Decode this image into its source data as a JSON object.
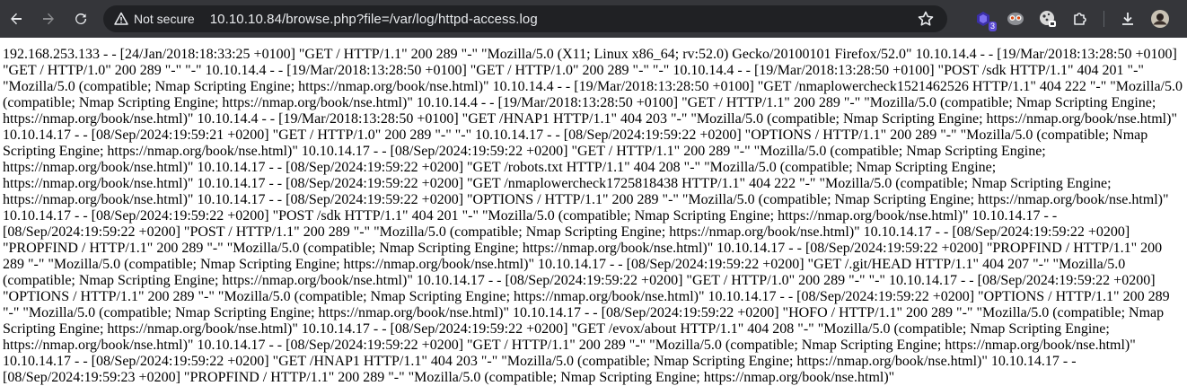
{
  "browser": {
    "security_label": "Not secure",
    "url": "10.10.10.84/browse.php?file=/var/log/httpd-access.log",
    "extensions": [
      {
        "name": "extension-1",
        "badge": "3"
      }
    ]
  },
  "page": {
    "log_text": "192.168.253.133 - - [24/Jan/2018:18:33:25 +0100] \"GET / HTTP/1.1\" 200 289 \"-\" \"Mozilla/5.0 (X11; Linux x86_64; rv:52.0) Gecko/20100101 Firefox/52.0\" 10.10.14.4 - - [19/Mar/2018:13:28:50 +0100] \"GET / HTTP/1.0\" 200 289 \"-\" \"-\" 10.10.14.4 - - [19/Mar/2018:13:28:50 +0100] \"GET / HTTP/1.0\" 200 289 \"-\" \"-\" 10.10.14.4 - - [19/Mar/2018:13:28:50 +0100] \"POST /sdk HTTP/1.1\" 404 201 \"-\" \"Mozilla/5.0 (compatible; Nmap Scripting Engine; https://nmap.org/book/nse.html)\" 10.10.14.4 - - [19/Mar/2018:13:28:50 +0100] \"GET /nmaplowercheck1521462526 HTTP/1.1\" 404 222 \"-\" \"Mozilla/5.0 (compatible; Nmap Scripting Engine; https://nmap.org/book/nse.html)\" 10.10.14.4 - - [19/Mar/2018:13:28:50 +0100] \"GET / HTTP/1.1\" 200 289 \"-\" \"Mozilla/5.0 (compatible; Nmap Scripting Engine; https://nmap.org/book/nse.html)\" 10.10.14.4 - - [19/Mar/2018:13:28:50 +0100] \"GET /HNAP1 HTTP/1.1\" 404 203 \"-\" \"Mozilla/5.0 (compatible; Nmap Scripting Engine; https://nmap.org/book/nse.html)\" 10.10.14.17 - - [08/Sep/2024:19:59:21 +0200] \"GET / HTTP/1.0\" 200 289 \"-\" \"-\" 10.10.14.17 - - [08/Sep/2024:19:59:22 +0200] \"OPTIONS / HTTP/1.1\" 200 289 \"-\" \"Mozilla/5.0 (compatible; Nmap Scripting Engine; https://nmap.org/book/nse.html)\" 10.10.14.17 - - [08/Sep/2024:19:59:22 +0200] \"GET / HTTP/1.1\" 200 289 \"-\" \"Mozilla/5.0 (compatible; Nmap Scripting Engine; https://nmap.org/book/nse.html)\" 10.10.14.17 - - [08/Sep/2024:19:59:22 +0200] \"GET /robots.txt HTTP/1.1\" 404 208 \"-\" \"Mozilla/5.0 (compatible; Nmap Scripting Engine; https://nmap.org/book/nse.html)\" 10.10.14.17 - - [08/Sep/2024:19:59:22 +0200] \"GET /nmaplowercheck1725818438 HTTP/1.1\" 404 222 \"-\" \"Mozilla/5.0 (compatible; Nmap Scripting Engine; https://nmap.org/book/nse.html)\" 10.10.14.17 - - [08/Sep/2024:19:59:22 +0200] \"OPTIONS / HTTP/1.1\" 200 289 \"-\" \"Mozilla/5.0 (compatible; Nmap Scripting Engine; https://nmap.org/book/nse.html)\" 10.10.14.17 - - [08/Sep/2024:19:59:22 +0200] \"POST /sdk HTTP/1.1\" 404 201 \"-\" \"Mozilla/5.0 (compatible; Nmap Scripting Engine; https://nmap.org/book/nse.html)\" 10.10.14.17 - - [08/Sep/2024:19:59:22 +0200] \"POST / HTTP/1.1\" 200 289 \"-\" \"Mozilla/5.0 (compatible; Nmap Scripting Engine; https://nmap.org/book/nse.html)\" 10.10.14.17 - - [08/Sep/2024:19:59:22 +0200] \"PROPFIND / HTTP/1.1\" 200 289 \"-\" \"Mozilla/5.0 (compatible; Nmap Scripting Engine; https://nmap.org/book/nse.html)\" 10.10.14.17 - - [08/Sep/2024:19:59:22 +0200] \"PROPFIND / HTTP/1.1\" 200 289 \"-\" \"Mozilla/5.0 (compatible; Nmap Scripting Engine; https://nmap.org/book/nse.html)\" 10.10.14.17 - - [08/Sep/2024:19:59:22 +0200] \"GET /.git/HEAD HTTP/1.1\" 404 207 \"-\" \"Mozilla/5.0 (compatible; Nmap Scripting Engine; https://nmap.org/book/nse.html)\" 10.10.14.17 - - [08/Sep/2024:19:59:22 +0200] \"GET / HTTP/1.0\" 200 289 \"-\" \"-\" 10.10.14.17 - - [08/Sep/2024:19:59:22 +0200] \"OPTIONS / HTTP/1.1\" 200 289 \"-\" \"Mozilla/5.0 (compatible; Nmap Scripting Engine; https://nmap.org/book/nse.html)\" 10.10.14.17 - - [08/Sep/2024:19:59:22 +0200] \"OPTIONS / HTTP/1.1\" 200 289 \"-\" \"Mozilla/5.0 (compatible; Nmap Scripting Engine; https://nmap.org/book/nse.html)\" 10.10.14.17 - - [08/Sep/2024:19:59:22 +0200] \"HOFO / HTTP/1.1\" 200 289 \"-\" \"Mozilla/5.0 (compatible; Nmap Scripting Engine; https://nmap.org/book/nse.html)\" 10.10.14.17 - - [08/Sep/2024:19:59:22 +0200] \"GET /evox/about HTTP/1.1\" 404 208 \"-\" \"Mozilla/5.0 (compatible; Nmap Scripting Engine; https://nmap.org/book/nse.html)\" 10.10.14.17 - - [08/Sep/2024:19:59:22 +0200] \"GET / HTTP/1.1\" 200 289 \"-\" \"Mozilla/5.0 (compatible; Nmap Scripting Engine; https://nmap.org/book/nse.html)\" 10.10.14.17 - - [08/Sep/2024:19:59:22 +0200] \"GET /HNAP1 HTTP/1.1\" 404 203 \"-\" \"Mozilla/5.0 (compatible; Nmap Scripting Engine; https://nmap.org/book/nse.html)\" 10.10.14.17 - - [08/Sep/2024:19:59:23 +0200] \"PROPFIND / HTTP/1.1\" 200 289 \"-\" \"Mozilla/5.0 (compatible; Nmap Scripting Engine; https://nmap.org/book/nse.html)\""
  },
  "colors": {
    "toolbar_bg": "#35363a",
    "omnibox_bg": "#202124",
    "toolbar_text": "#e8eaed",
    "page_bg": "#ffffff",
    "page_text": "#000000"
  }
}
